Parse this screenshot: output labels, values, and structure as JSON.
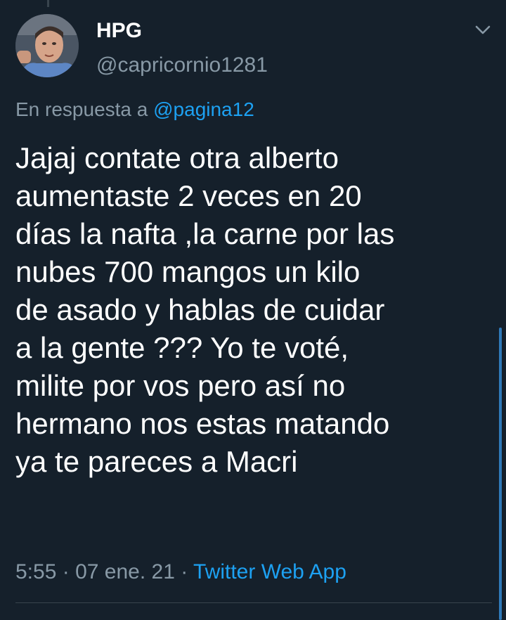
{
  "tweet": {
    "author": {
      "display_name": "HPG",
      "handle": "@capricornio1281",
      "avatar_icon": "user-avatar"
    },
    "reply_prefix": "En respuesta a",
    "reply_mention": "@pagina12",
    "text": "Jajaj contate otra alberto\naumentaste 2 veces en 20\ndías la nafta ,la carne por las\nnubes 700 mangos un kilo\nde asado y hablas de cuidar\na la gente ??? Yo te voté,\nmilite por vos pero así no\nhermano nos estas matando\nya te pareces a Macri",
    "time": "5:55",
    "separator": "·",
    "date": "07 ene. 21",
    "source": "Twitter Web App"
  },
  "icons": {
    "menu": "chevron-down-icon"
  },
  "colors": {
    "background": "#15202b",
    "text_primary": "#ffffff",
    "text_secondary": "#8899a6",
    "accent": "#1da1f2",
    "divider": "#38444d"
  }
}
